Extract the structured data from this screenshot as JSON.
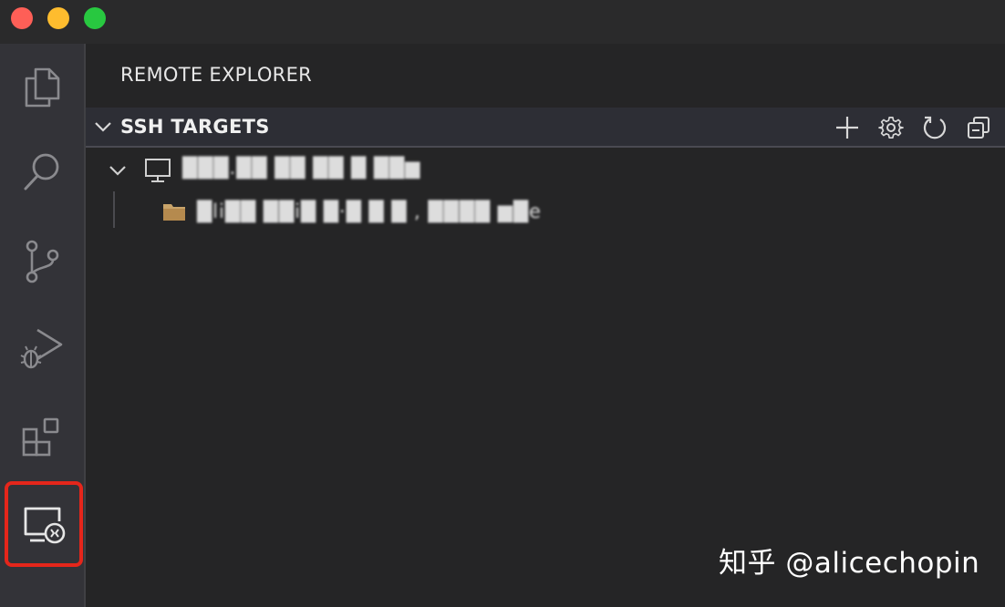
{
  "window": {
    "controls": [
      "close",
      "minimize",
      "zoom"
    ]
  },
  "activity_bar": {
    "items": [
      {
        "icon": "files-icon",
        "active": false
      },
      {
        "icon": "search-icon",
        "active": false
      },
      {
        "icon": "source-control-icon",
        "active": false
      },
      {
        "icon": "run-debug-icon",
        "active": false
      },
      {
        "icon": "extensions-icon",
        "active": false
      },
      {
        "icon": "remote-explorer-icon",
        "active": true
      }
    ]
  },
  "sidebar": {
    "title": "REMOTE EXPLORER",
    "section": {
      "title": "SSH TARGETS",
      "actions": [
        "add-icon",
        "gear-icon",
        "refresh-icon",
        "collapse-all-icon"
      ]
    },
    "tree": {
      "host_label": "███.██ ██ ██ █ ██▆",
      "folder_label": "█li██ ██i█ █·█ █ █ , ████ ▆█e"
    }
  },
  "colors": {
    "background": "#252526",
    "activity_bar": "#333338",
    "section_header": "#2d2e35",
    "highlight": "#e5261b",
    "folder": "#c9a46a"
  },
  "watermark": "知乎 @alicechopin"
}
